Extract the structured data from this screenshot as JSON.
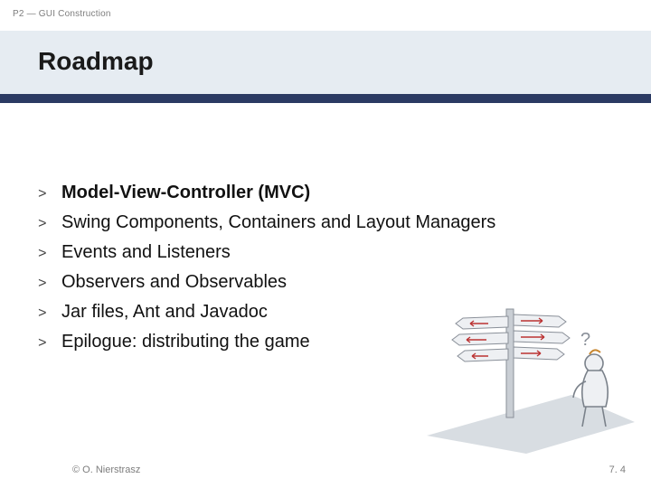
{
  "header": {
    "topline": "P2 — GUI Construction",
    "title": "Roadmap"
  },
  "bullet_glyph": ">",
  "items": [
    {
      "text": "Model-View-Controller (MVC)",
      "emph": true
    },
    {
      "text": "Swing Components, Containers and Layout Managers",
      "emph": false
    },
    {
      "text": "Events and Listeners",
      "emph": false
    },
    {
      "text": "Observers and Observables",
      "emph": false
    },
    {
      "text": "Jar files, Ant and Javadoc",
      "emph": false
    },
    {
      "text": "Epilogue: distributing the game",
      "emph": false
    }
  ],
  "footer": {
    "left": "© O. Nierstrasz",
    "right": "7. 4"
  }
}
